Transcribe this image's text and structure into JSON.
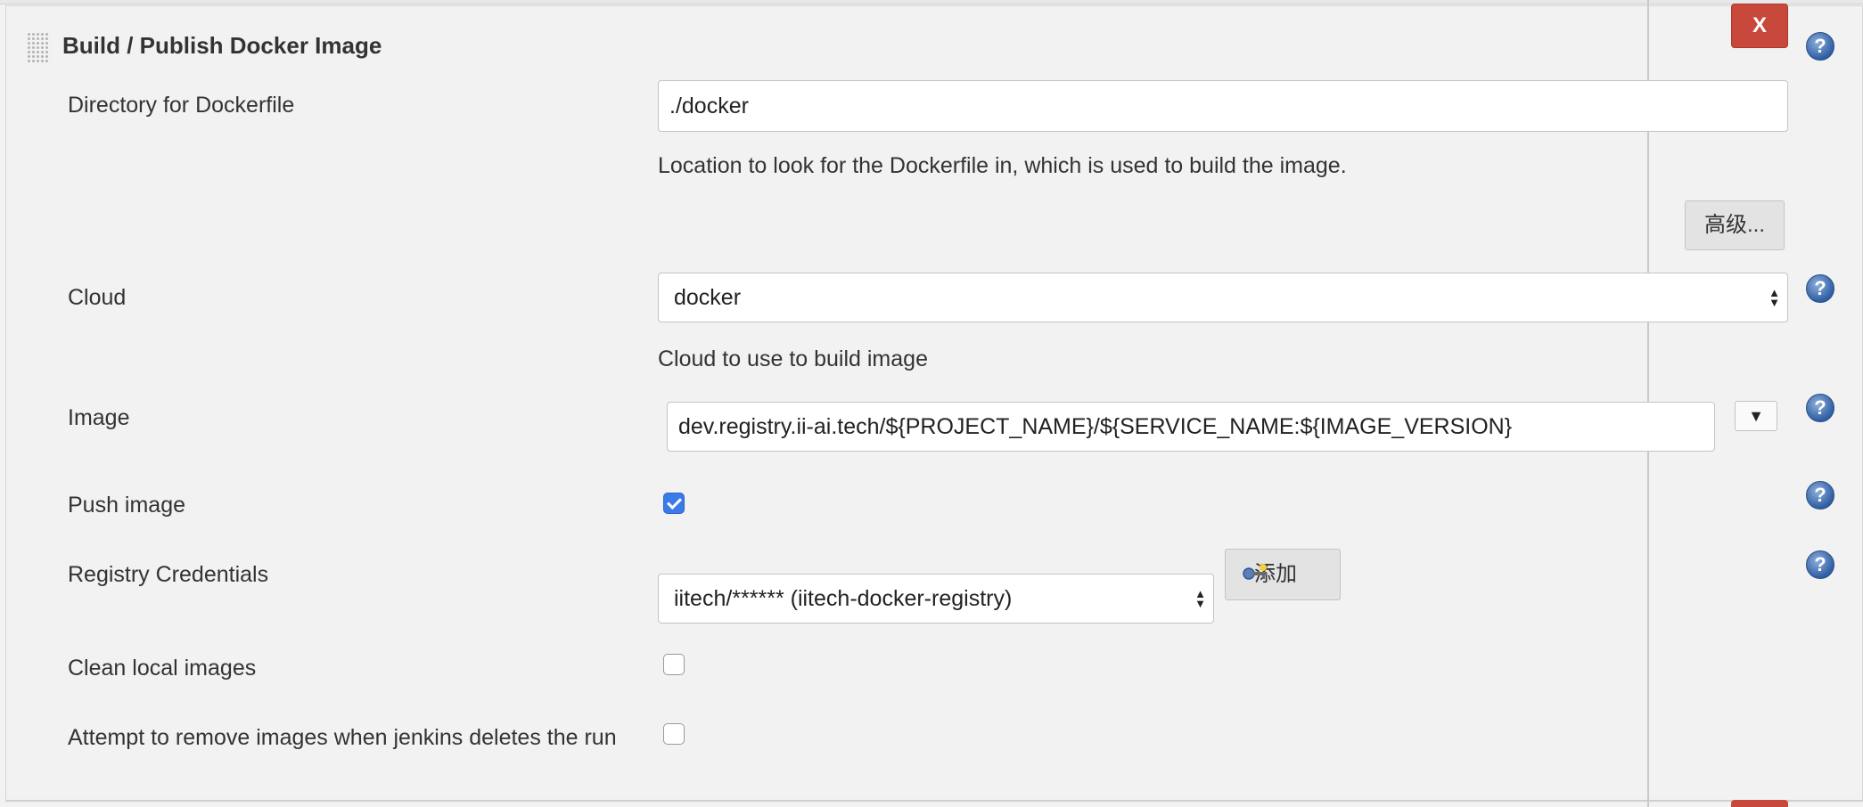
{
  "section": {
    "title": "Build / Publish Docker Image",
    "close_label": "X"
  },
  "help_icon": "?",
  "dockerfile": {
    "label": "Directory for Dockerfile",
    "value": "./docker",
    "description": "Location to look for the Dockerfile in, which is used to build the image."
  },
  "advanced_button": "高级...",
  "cloud": {
    "label": "Cloud",
    "selected": "docker",
    "description": "Cloud to use to build image"
  },
  "image": {
    "label": "Image",
    "value": "dev.registry.ii-ai.tech/${PROJECT_NAME}/${SERVICE_NAME:${IMAGE_VERSION}",
    "dropdown_glyph": "▼"
  },
  "push_image": {
    "label": "Push image",
    "checked": true
  },
  "registry_credentials": {
    "label": "Registry Credentials",
    "selected": "iitech/****** (iitech-docker-registry)",
    "add_button": "添加"
  },
  "clean_local_images": {
    "label": "Clean local images",
    "checked": false
  },
  "remove_images": {
    "label": "Attempt to remove images when jenkins deletes the run",
    "checked": false
  },
  "colors": {
    "close_button": "#c9483c",
    "checkbox_checked": "#3b7be9",
    "help_icon": "#2f5ea3"
  },
  "icons": [
    "drag-handle-icon",
    "help-icon",
    "key-icon",
    "select-arrows-icon",
    "dropdown-arrow-icon",
    "checkmark-icon"
  ]
}
